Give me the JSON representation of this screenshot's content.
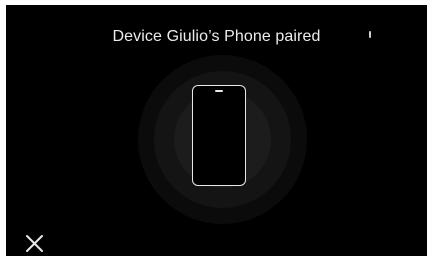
{
  "dialog": {
    "message": "Device Giulio’s Phone paired"
  },
  "icons": {
    "device": "phone-icon",
    "close": "close-icon"
  },
  "colors": {
    "background": "#000000",
    "text": "#ececec",
    "icon_stroke": "#e8e8e8"
  }
}
